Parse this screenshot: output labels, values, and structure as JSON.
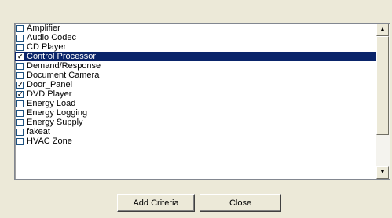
{
  "list": {
    "items": [
      {
        "label": "Amplifier",
        "checked": false,
        "selected": false
      },
      {
        "label": "Audio Codec",
        "checked": false,
        "selected": false
      },
      {
        "label": "CD Player",
        "checked": false,
        "selected": false
      },
      {
        "label": "Control Processor",
        "checked": true,
        "selected": true
      },
      {
        "label": "Demand/Response",
        "checked": false,
        "selected": false
      },
      {
        "label": "Document Camera",
        "checked": false,
        "selected": false
      },
      {
        "label": "Door_Panel",
        "checked": true,
        "selected": false
      },
      {
        "label": "DVD Player",
        "checked": true,
        "selected": false
      },
      {
        "label": "Energy Load",
        "checked": false,
        "selected": false
      },
      {
        "label": "Energy Logging",
        "checked": false,
        "selected": false
      },
      {
        "label": "Energy Supply",
        "checked": false,
        "selected": false
      },
      {
        "label": "fakeat",
        "checked": false,
        "selected": false
      },
      {
        "label": "HVAC Zone",
        "checked": false,
        "selected": false
      }
    ]
  },
  "buttons": {
    "add_criteria_label": "Add Criteria",
    "close_label": "Close"
  },
  "colors": {
    "background": "#ece9d8",
    "selection": "#0a246a"
  },
  "icons": {
    "check": "✓",
    "scroll_up": "▲",
    "scroll_down": "▼"
  }
}
